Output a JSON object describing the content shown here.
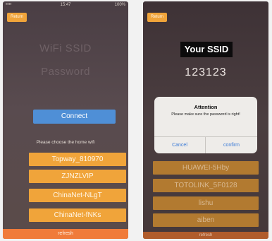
{
  "left_screen": {
    "status": {
      "signal": "••••",
      "time": "15:47",
      "battery": "100%"
    },
    "back_label": "Return",
    "ssid_placeholder": "WiFi SSID",
    "password_placeholder": "Password",
    "connect_label": "Connect",
    "choose_label": "Please choose the home wifi",
    "wifi_list": [
      "Topway_810970",
      "ZJNZLVIP",
      "ChinaNet-NLgT",
      "ChinaNet-fNKs"
    ],
    "refresh_label": "refresh"
  },
  "right_screen": {
    "back_label": "Return",
    "ssid_value": "Your SSID",
    "password_value": "123123",
    "wifi_list": [
      "HUAWEI-5Hby",
      "TOTOLINK_5F0128",
      "lishu",
      "aiben"
    ],
    "refresh_label": "refresh",
    "alert": {
      "title": "Attention",
      "message": "Please make sure the password is right!",
      "cancel_label": "Cancel",
      "confirm_label": "confirm"
    }
  },
  "colors": {
    "accent_orange": "#f0a43a",
    "connect_blue": "#4f8fd6",
    "refresh_orange": "#f07b3a",
    "alert_link": "#3a7ad6"
  }
}
